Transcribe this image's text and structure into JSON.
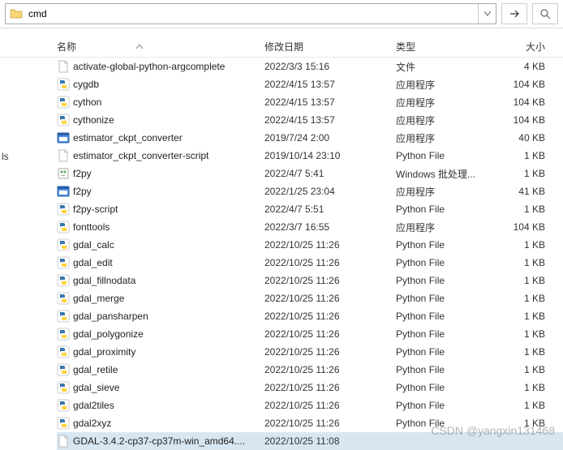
{
  "address": {
    "path": "cmd",
    "go_title": "→",
    "search_title": ""
  },
  "left_nav": {
    "label": "ls"
  },
  "columns": {
    "name": "名称",
    "date": "修改日期",
    "type": "类型",
    "size": "大小"
  },
  "files": [
    {
      "icon": "blank",
      "name": "activate-global-python-argcomplete",
      "date": "2022/3/3 15:16",
      "type": "文件",
      "size": "4 KB",
      "sel": false
    },
    {
      "icon": "py",
      "name": "cygdb",
      "date": "2022/4/15 13:57",
      "type": "应用程序",
      "size": "104 KB",
      "sel": false
    },
    {
      "icon": "py",
      "name": "cython",
      "date": "2022/4/15 13:57",
      "type": "应用程序",
      "size": "104 KB",
      "sel": false
    },
    {
      "icon": "py",
      "name": "cythonize",
      "date": "2022/4/15 13:57",
      "type": "应用程序",
      "size": "104 KB",
      "sel": false
    },
    {
      "icon": "exe",
      "name": "estimator_ckpt_converter",
      "date": "2019/7/24 2:00",
      "type": "应用程序",
      "size": "40 KB",
      "sel": false
    },
    {
      "icon": "blank",
      "name": "estimator_ckpt_converter-script",
      "date": "2019/10/14 23:10",
      "type": "Python File",
      "size": "1 KB",
      "sel": false
    },
    {
      "icon": "bat",
      "name": "f2py",
      "date": "2022/4/7 5:41",
      "type": "Windows 批处理...",
      "size": "1 KB",
      "sel": false
    },
    {
      "icon": "exe",
      "name": "f2py",
      "date": "2022/1/25 23:04",
      "type": "应用程序",
      "size": "41 KB",
      "sel": false
    },
    {
      "icon": "py",
      "name": "f2py-script",
      "date": "2022/4/7 5:51",
      "type": "Python File",
      "size": "1 KB",
      "sel": false
    },
    {
      "icon": "py",
      "name": "fonttools",
      "date": "2022/3/7 16:55",
      "type": "应用程序",
      "size": "104 KB",
      "sel": false
    },
    {
      "icon": "py",
      "name": "gdal_calc",
      "date": "2022/10/25 11:26",
      "type": "Python File",
      "size": "1 KB",
      "sel": false
    },
    {
      "icon": "py",
      "name": "gdal_edit",
      "date": "2022/10/25 11:26",
      "type": "Python File",
      "size": "1 KB",
      "sel": false
    },
    {
      "icon": "py",
      "name": "gdal_fillnodata",
      "date": "2022/10/25 11:26",
      "type": "Python File",
      "size": "1 KB",
      "sel": false
    },
    {
      "icon": "py",
      "name": "gdal_merge",
      "date": "2022/10/25 11:26",
      "type": "Python File",
      "size": "1 KB",
      "sel": false
    },
    {
      "icon": "py",
      "name": "gdal_pansharpen",
      "date": "2022/10/25 11:26",
      "type": "Python File",
      "size": "1 KB",
      "sel": false
    },
    {
      "icon": "py",
      "name": "gdal_polygonize",
      "date": "2022/10/25 11:26",
      "type": "Python File",
      "size": "1 KB",
      "sel": false
    },
    {
      "icon": "py",
      "name": "gdal_proximity",
      "date": "2022/10/25 11:26",
      "type": "Python File",
      "size": "1 KB",
      "sel": false
    },
    {
      "icon": "py",
      "name": "gdal_retile",
      "date": "2022/10/25 11:26",
      "type": "Python File",
      "size": "1 KB",
      "sel": false
    },
    {
      "icon": "py",
      "name": "gdal_sieve",
      "date": "2022/10/25 11:26",
      "type": "Python File",
      "size": "1 KB",
      "sel": false
    },
    {
      "icon": "py",
      "name": "gdal2tiles",
      "date": "2022/10/25 11:26",
      "type": "Python File",
      "size": "1 KB",
      "sel": false
    },
    {
      "icon": "py",
      "name": "gdal2xyz",
      "date": "2022/10/25 11:26",
      "type": "Python File",
      "size": "1 KB",
      "sel": false
    },
    {
      "icon": "blank",
      "name": "GDAL-3.4.2-cp37-cp37m-win_amd64....",
      "date": "2022/10/25 11:08",
      "type": "",
      "size": "",
      "sel": true
    }
  ],
  "watermark": "CSDN @yangxin131468"
}
